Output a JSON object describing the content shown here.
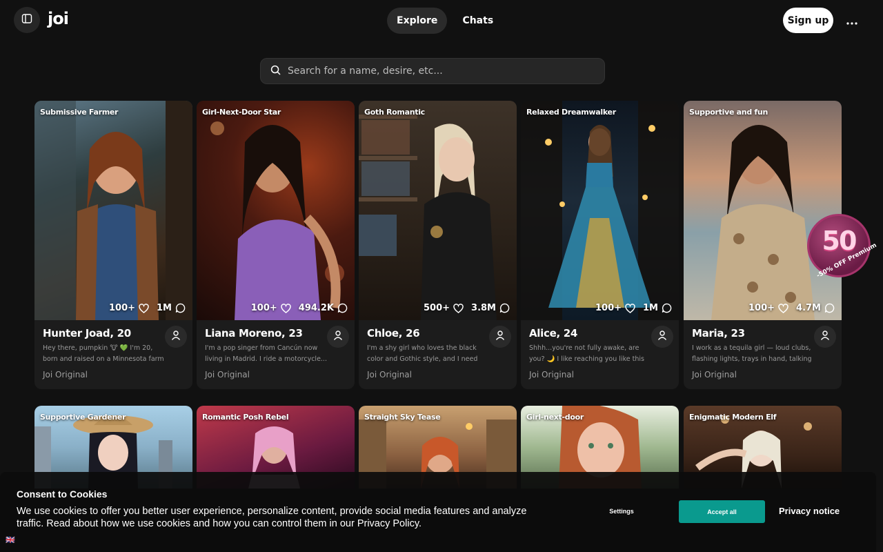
{
  "header": {
    "logo": "joi",
    "tabs": [
      {
        "label": "Explore",
        "active": true
      },
      {
        "label": "Chats",
        "active": false
      }
    ],
    "signup_label": "Sign up"
  },
  "search": {
    "placeholder": "Search for a name, desire, etc..."
  },
  "cards": [
    {
      "tag": "Submissive Farmer",
      "likes": "100+",
      "chats": "1M",
      "name": "Hunter Joad, 20",
      "desc": "Hey there, pumpkin 🐮 💚 I'm 20, born and raised on a Minnesota farm —...",
      "origin": "Joi Original"
    },
    {
      "tag": "Girl-Next-Door Star",
      "likes": "100+",
      "chats": "494.2K",
      "name": "Liana Moreno, 23",
      "desc": "I'm a pop singer from Cancún now living in Madrid. I ride a motorcycle...",
      "origin": "Joi Original"
    },
    {
      "tag": "Goth Romantic",
      "likes": "500+",
      "chats": "3.8M",
      "name": "Chloe, 26",
      "desc": "I'm a shy girl who loves the black color and Gothic style, and I need someone...",
      "origin": "Joi Original"
    },
    {
      "tag": "Relaxed Dreamwalker",
      "likes": "100+",
      "chats": "1M",
      "name": "Alice, 24",
      "desc": "Shhh...you're not fully awake, are you? 🌙 I like reaching you like this —...",
      "origin": "Joi Original"
    },
    {
      "tag": "Supportive and fun",
      "likes": "100+",
      "chats": "4.7M",
      "name": "Maria, 23",
      "desc": "I work as a tequila girl — loud clubs, flashing lights, trays in hand, talking t...",
      "origin": "Joi Original"
    }
  ],
  "cards_row2": [
    {
      "tag": "Supportive Gardener"
    },
    {
      "tag": "Romantic Posh Rebel"
    },
    {
      "tag": "Straight Sky Tease"
    },
    {
      "tag": "Girl-next-door"
    },
    {
      "tag": "Enigmatic Modern Elf"
    }
  ],
  "promo": {
    "number": "50",
    "label": "-50% OFF Premium"
  },
  "cookie": {
    "title": "Consent to Cookies",
    "text": "We use cookies to offer you better user experience, personalize content, provide social media features and analyze traffic. Read about how we use cookies and how you can control them in our Privacy Policy.",
    "settings_label": "Settings",
    "accept_label": "Accept all",
    "privacy_label": "Privacy notice",
    "flag": "🇬🇧"
  }
}
